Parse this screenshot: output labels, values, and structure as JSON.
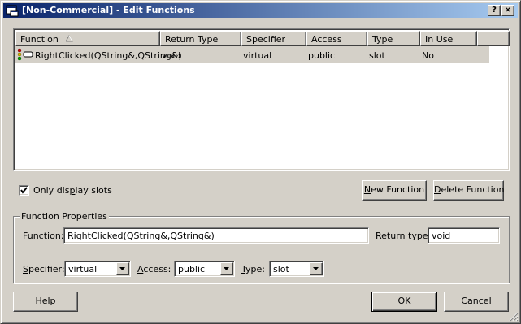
{
  "window": {
    "title": "[Non-Commercial] - Edit Functions",
    "help_btn": "?",
    "close_btn": "×"
  },
  "list": {
    "columns": [
      "Function",
      "Return Type",
      "Specifier",
      "Access",
      "Type",
      "In Use"
    ],
    "rows": [
      {
        "function": "RightClicked(QString&,QString&)",
        "return_type": "void",
        "specifier": "virtual",
        "access": "public",
        "type": "slot",
        "in_use": "No"
      }
    ]
  },
  "filter": {
    "only_slots_prefix": "Only dis",
    "only_slots_mnemonic": "p",
    "only_slots_suffix": "lay slots",
    "checked": true
  },
  "buttons": {
    "new_mnemonic": "N",
    "new_rest": "ew Function",
    "delete_prefix": "",
    "delete_mnemonic": "D",
    "delete_rest": "elete Function",
    "help_mnemonic": "H",
    "help_rest": "elp",
    "ok_mnemonic": "O",
    "ok_rest": "K",
    "cancel_mnemonic": "C",
    "cancel_rest": "ancel"
  },
  "properties": {
    "group_title": "Function Properties",
    "function_label_mnemonic": "F",
    "function_label_rest": "unction:",
    "function_value": "RightClicked(QString&,QString&)",
    "return_label_mnemonic": "R",
    "return_label_rest": "eturn type:",
    "return_value": "void",
    "specifier_label_mnemonic": "S",
    "specifier_label_rest": "pecifier:",
    "specifier_value": "virtual",
    "access_label_mnemonic": "A",
    "access_label_rest": "ccess:",
    "access_value": "public",
    "type_label_mnemonic": "T",
    "type_label_rest": "ype:",
    "type_value": "slot"
  },
  "colors": {
    "titlebar_start": "#0a246a",
    "titlebar_end": "#a6caf0",
    "face": "#d4d0c8",
    "row_selected": "#d4d0c8"
  },
  "icons": {
    "app": "window-edit-icon",
    "row": "slot-function-icon",
    "sort": "sort-ascending-icon"
  }
}
